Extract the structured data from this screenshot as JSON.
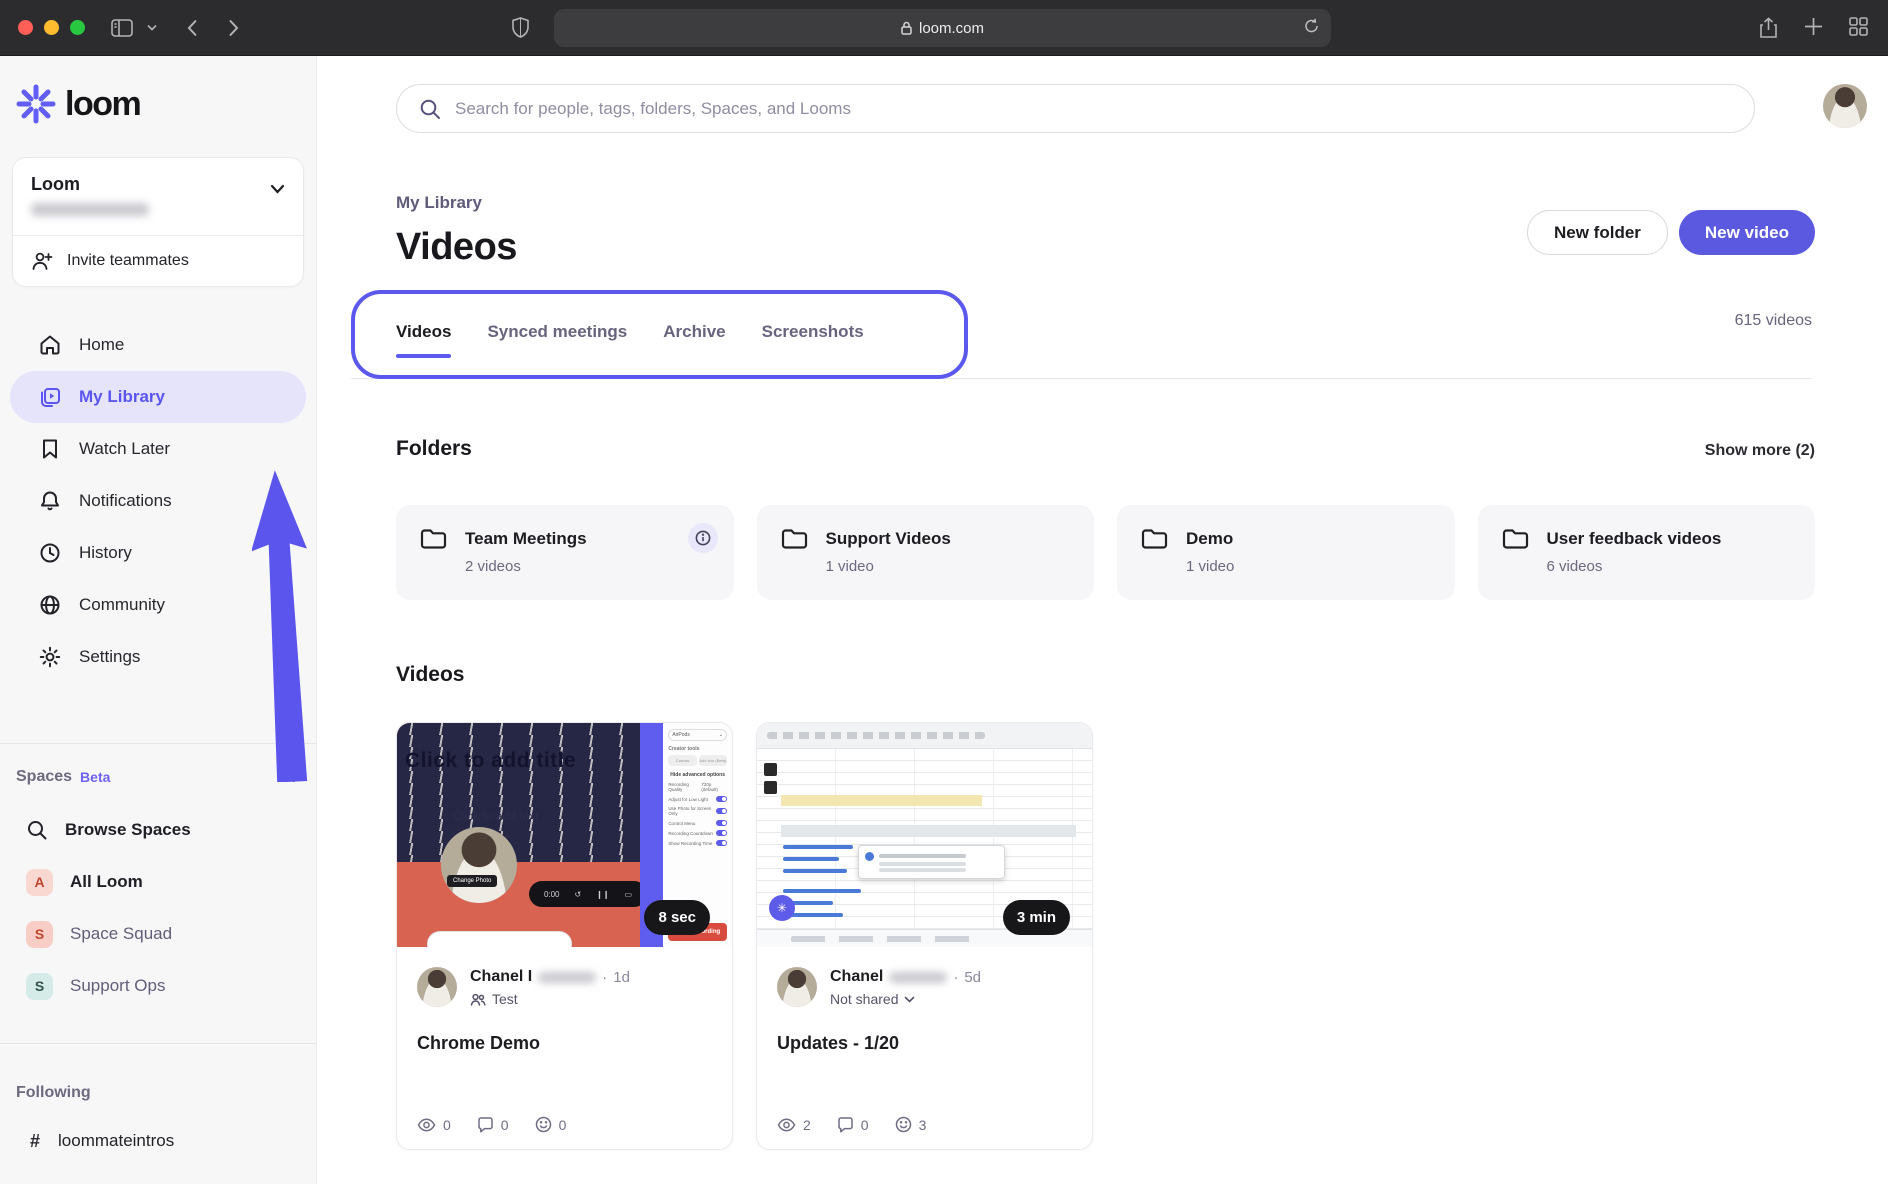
{
  "colors": {
    "accent": "#5d5af0",
    "annotation": "#5b58ee",
    "new_video_button": "#5a59e0",
    "active_nav_bg": "#e5e4fb",
    "thumb_navy": "#262645",
    "thumb_coral": "#d96351",
    "start_recording_red": "#d84b3e"
  },
  "browser": {
    "url": "loom.com"
  },
  "sidebar": {
    "logo_text": "loom",
    "workspace": {
      "name": "Loom"
    },
    "invite_label": "Invite teammates",
    "nav": [
      {
        "label": "Home"
      },
      {
        "label": "My Library"
      },
      {
        "label": "Watch Later"
      },
      {
        "label": "Notifications"
      },
      {
        "label": "History"
      },
      {
        "label": "Community"
      },
      {
        "label": "Settings"
      }
    ],
    "spaces": {
      "title": "Spaces",
      "badge": "Beta",
      "add_label": "+",
      "items": [
        {
          "label": "Browse Spaces"
        },
        {
          "label": "All Loom",
          "initial": "A"
        },
        {
          "label": "Space Squad",
          "initial": "S"
        },
        {
          "label": "Support Ops",
          "initial": "S"
        }
      ]
    },
    "following": {
      "title": "Following",
      "items": [
        {
          "glyph": "#",
          "label": "loommateintros"
        }
      ]
    }
  },
  "header": {
    "search_placeholder": "Search for people, tags, folders, Spaces, and Looms",
    "breadcrumb": "My Library",
    "title": "Videos",
    "new_folder": "New folder",
    "new_video": "New video"
  },
  "tabs": {
    "items": [
      {
        "label": "Videos"
      },
      {
        "label": "Synced meetings"
      },
      {
        "label": "Archive"
      },
      {
        "label": "Screenshots"
      }
    ],
    "count_label": "615 videos"
  },
  "folders": {
    "title": "Folders",
    "show_more": "Show more (2)",
    "items": [
      {
        "name": "Team Meetings",
        "count": "2 videos"
      },
      {
        "name": "Support Videos",
        "count": "1 video"
      },
      {
        "name": "Demo",
        "count": "1 video"
      },
      {
        "name": "User feedback videos",
        "count": "6 videos"
      }
    ]
  },
  "videos": {
    "title": "Videos",
    "items": [
      {
        "title": "Chrome Demo",
        "duration": "8 sec",
        "owner": "Chanel I",
        "posted": "1d",
        "share_label": "Test",
        "stats": {
          "views": "0",
          "comments": "0",
          "reactions": "0"
        },
        "thumb": {
          "overlay_title": "Click to add title",
          "overlay_subtitle": "Click to add text",
          "change_photo": "Change Photo",
          "timer": "0:00",
          "device": "AirPods",
          "creator_tools": "Creator tools",
          "canvas": "Canvas",
          "add_blur": "Add blur (Beta)",
          "hide_options": "Hide advanced options",
          "advanced": "Advanced Options",
          "quality_label": "Recording Quality",
          "quality_value": "720p (default)",
          "toggles": [
            {
              "label": "Adjust for Low Light"
            },
            {
              "label": "Use Photo for Screen Only"
            },
            {
              "label": "Control Menu"
            },
            {
              "label": "Recording Countdown"
            },
            {
              "label": "Show Recording Time"
            }
          ],
          "start_button": "Start Recording"
        }
      },
      {
        "title": "Updates - 1/20",
        "duration": "3 min",
        "owner": "Chanel",
        "posted": "5d",
        "share_label": "Not shared",
        "stats": {
          "views": "2",
          "comments": "0",
          "reactions": "3"
        }
      }
    ]
  },
  "ui": {
    "dot": "·"
  }
}
